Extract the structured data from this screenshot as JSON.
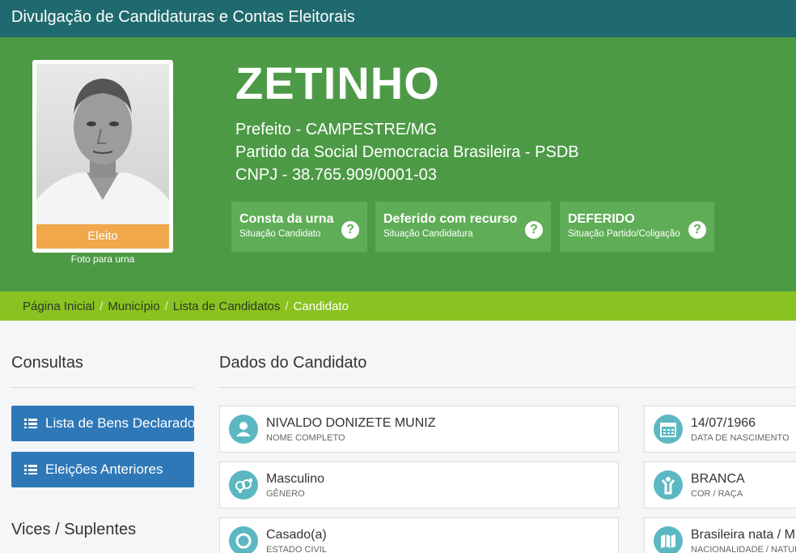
{
  "app": {
    "title": "Divulgação de Candidaturas e Contas Eleitorais"
  },
  "candidate": {
    "photo_badge": "Eleito",
    "photo_caption": "Foto para urna",
    "ballot_name": "ZETINHO",
    "office_line": "Prefeito - CAMPESTRE/MG",
    "party_line": "Partido da Social Democracia Brasileira - PSDB",
    "cnpj_line": "CNPJ - 38.765.909/0001-03"
  },
  "statuses": [
    {
      "title": "Consta da urna",
      "subtitle": "Situação Candidato"
    },
    {
      "title": "Deferido com recurso",
      "subtitle": "Situação Candidatura"
    },
    {
      "title": "DEFERIDO",
      "subtitle": "Situação Partido/Coligação"
    }
  ],
  "help_glyph": "?",
  "breadcrumb": {
    "items": [
      "Página Inicial",
      "Município",
      "Lista de Candidatos",
      "Candidato"
    ],
    "separator": "/"
  },
  "sidebar": {
    "title": "Consultas",
    "buttons": [
      "Lista de Bens Declarados",
      "Eleições Anteriores"
    ],
    "section2_title": "Vices / Suplentes"
  },
  "main": {
    "title": "Dados do Candidato",
    "fields": [
      {
        "value": "NIVALDO DONIZETE MUNIZ",
        "label": "NOME COMPLETO",
        "icon": "person-icon"
      },
      {
        "value": "14/07/1966",
        "label": "DATA DE NASCIMENTO",
        "icon": "calendar-icon"
      },
      {
        "value": "Masculino",
        "label": "GÊNERO",
        "icon": "gender-icon"
      },
      {
        "value": "BRANCA",
        "label": "COR / RAÇA",
        "icon": "raised-arms-person-icon"
      },
      {
        "value": "Casado(a)",
        "label": "ESTADO CIVIL",
        "icon": "ring-icon"
      },
      {
        "value": "Brasileira nata / M",
        "label": "NACIONALIDADE / NATUR",
        "icon": "map-icon"
      }
    ]
  },
  "colors": {
    "topbar": "#1f6a6e",
    "hero": "#4c9a45",
    "status_box": "#5fae57",
    "breadcrumb_bar": "#8ac321",
    "badge": "#f0a84a",
    "sidebar_button": "#2f78b7",
    "field_icon": "#5bb8c2"
  }
}
